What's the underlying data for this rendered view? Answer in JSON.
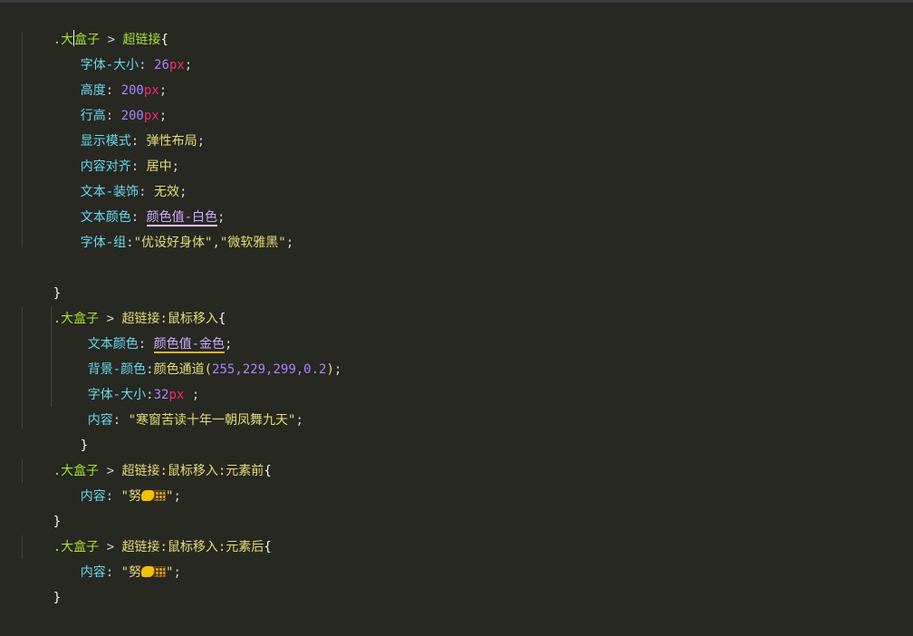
{
  "code": {
    "rule1": {
      "selector_start": ".大",
      "selector_end": "盒子",
      "combinator": " > ",
      "target": "超链接",
      "open": "{",
      "decls": [
        {
          "prop": "字体-大小",
          "sep": ": ",
          "num": "26",
          "unit": "px",
          "end": ";"
        },
        {
          "prop": "高度",
          "sep": ": ",
          "num": "200",
          "unit": "px",
          "end": ";"
        },
        {
          "prop": "行高",
          "sep": ": ",
          "num": "200",
          "unit": "px",
          "end": ";"
        },
        {
          "prop": "显示模式",
          "sep": ": ",
          "val": "弹性布局",
          "end": ";"
        },
        {
          "prop": "内容对齐",
          "sep": ": ",
          "val": "居中",
          "end": ";"
        },
        {
          "prop": "文本-装饰",
          "sep": ": ",
          "val": "无效",
          "end": ";"
        },
        {
          "prop": "文本颜色",
          "sep": ": ",
          "val": "颜色值-白色",
          "end": ";"
        },
        {
          "prop": "字体-组",
          "sep": ":",
          "val": "\"优设好身体\",\"微软雅黑\"",
          "end": ";"
        }
      ],
      "close": "}"
    },
    "rule2": {
      "selector": ".大盒子",
      "combinator": " > ",
      "target": "超链接:鼠标移入",
      "open": "{",
      "decls": [
        {
          "prop": "文本颜色",
          "sep": ": ",
          "val": "颜色值-金色",
          "end": ";"
        },
        {
          "prop": "背景-颜色",
          "sep": ":",
          "val_pre": "颜色通道(",
          "nums": "255,229,299,0.2",
          "val_post": ")",
          "end": ";"
        },
        {
          "prop": "字体-大小",
          "sep": ":",
          "num": "32",
          "unit": "px",
          "end": " ;"
        },
        {
          "prop": "内容",
          "sep": ": ",
          "val": "\"寒窗苦读十年一朝凤舞九天\"",
          "end": ";"
        }
      ],
      "close": "}"
    },
    "rule3": {
      "selector": ".大盒子",
      "combinator": " > ",
      "target": "超链接:鼠标移入:元素前",
      "open": "{",
      "prop": "内容",
      "sep": ": ",
      "str_pre": "\"努",
      "str_post": "\"",
      "end": ";",
      "close": "}"
    },
    "rule4": {
      "selector": ".大盒子",
      "combinator": " > ",
      "target": "超链接:鼠标移入:元素后",
      "open": "{",
      "prop": "内容",
      "sep": ": ",
      "str_pre": "\"努",
      "str_post": "\"",
      "end": ";",
      "close": "}"
    }
  },
  "icons": [
    "flexed-biceps-emoji",
    "abacus-emoji"
  ],
  "colors": {
    "background": "#272822",
    "selector": "#a6e22e",
    "property": "#66d9ef",
    "number": "#ae81ff",
    "unit": "#f92672",
    "value": "#e6db74"
  }
}
